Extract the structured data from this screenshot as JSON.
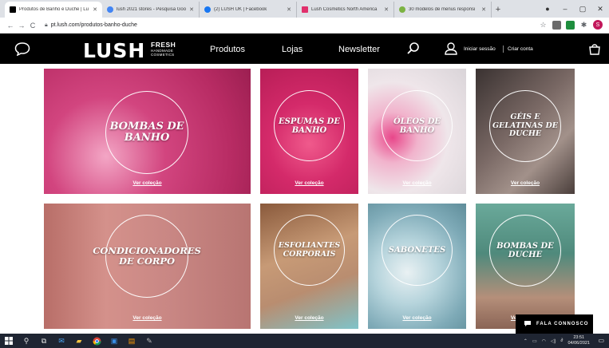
{
  "browser": {
    "tabs": [
      {
        "title": "Produtos de Banho e Duche | Lu",
        "favicon_color": "#000000",
        "active": true
      },
      {
        "title": "lush 2021 stores - Pesquisa Goo",
        "favicon_color": "#4285f4",
        "active": false
      },
      {
        "title": "(2) LUSH UK | Facebook",
        "favicon_color": "#1877f2",
        "active": false
      },
      {
        "title": "Lush Cosmetics North America",
        "favicon_color": "#e1306c",
        "active": false
      },
      {
        "title": "30 modelos de menus responsi",
        "favicon_color": "#7cb342",
        "active": false
      }
    ],
    "new_tab": "+",
    "url": "pt.lush.com/produtos-banho-duche",
    "controls": {
      "back": "←",
      "forward": "→",
      "reload": "C",
      "minimize": "–",
      "maximize": "▢",
      "close": "✕"
    },
    "avatar_letter": "S"
  },
  "header": {
    "logo": "LUSH",
    "logo_fresh": "FRESH",
    "logo_handmade": "HANDMADE",
    "logo_cosmetics": "COSMETICS",
    "nav": [
      "Produtos",
      "Lojas",
      "Newsletter"
    ],
    "login": "Iniciar sessão",
    "signup": "Criar conta",
    "icons": [
      "chat-icon",
      "search-icon",
      "user-icon",
      "cart-icon"
    ]
  },
  "tiles": [
    {
      "label": "BOMBAS DE\nBANHO",
      "link": "Ver coleção",
      "color": "#c2386f"
    },
    {
      "label": "ESPUMAS DE\nBANHO",
      "link": "Ver coleção",
      "color": "#d42a6a"
    },
    {
      "label": "ÓLEOS DE\nBANHO",
      "link": "Ver coleção",
      "color": "#e7d4dc"
    },
    {
      "label": "GÉIS E\nGELATINAS DE\nDUCHE",
      "link": "Ver coleção",
      "color": "#6d5a55"
    },
    {
      "label": "CONDICIONADORES\nDE CORPO",
      "link": "Ver coleção",
      "color": "#c57a76"
    },
    {
      "label": "ESFOLIANTES\nCORPORAIS",
      "link": "Ver coleção",
      "color": "#b48668"
    },
    {
      "label": "SABONETES",
      "link": "Ver coleção",
      "color": "#9fc4cf"
    },
    {
      "label": "BOMBAS DE\nDUCHE",
      "link": "Ver coleção",
      "color": "#5f9586"
    }
  ],
  "chat_widget": {
    "label": "FALA CONNOSCO"
  },
  "taskbar": {
    "time": "23:51",
    "date": "04/06/2021"
  }
}
